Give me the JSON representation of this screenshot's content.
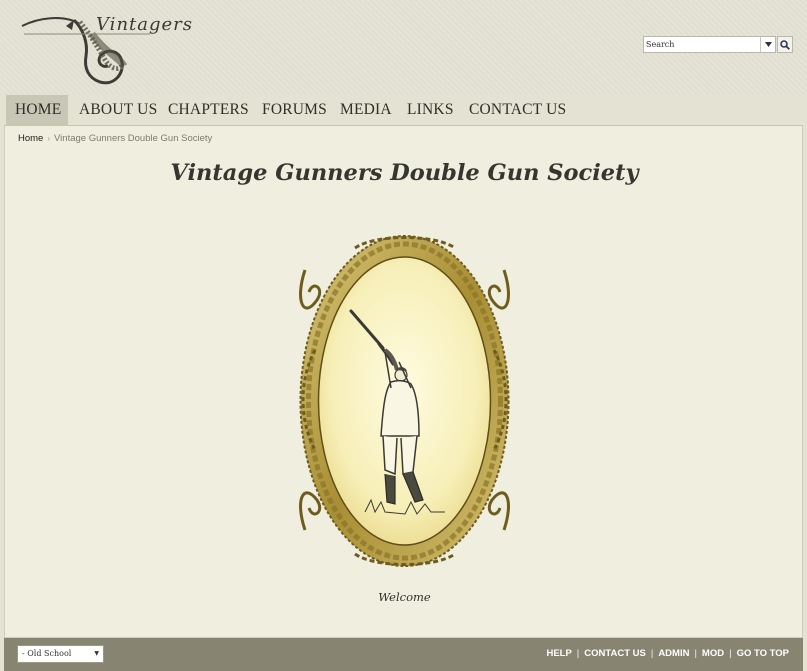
{
  "header": {
    "logo_text": "Vintagers",
    "search": {
      "placeholder": "Search"
    }
  },
  "nav": {
    "items": [
      {
        "label": "HOME"
      },
      {
        "label": "ABOUT US"
      },
      {
        "label": "CHAPTERS"
      },
      {
        "label": "FORUMS"
      },
      {
        "label": "MEDIA"
      },
      {
        "label": "LINKS"
      },
      {
        "label": "CONTACT US"
      }
    ]
  },
  "breadcrumb": {
    "home": "Home",
    "separator": "›",
    "current": "Vintage Gunners Double Gun Society"
  },
  "main": {
    "title": "Vintage Gunners Double Gun Society",
    "caption": "Welcome"
  },
  "footer": {
    "style_chooser": "- Old School",
    "links": [
      "HELP",
      "CONTACT US",
      "ADMIN",
      "MOD",
      "GO TO TOP"
    ],
    "separator": "|"
  },
  "icons": {
    "logo": "fish-logo-icon",
    "search": "search-icon",
    "dropdown": "chevron-down-icon",
    "hero": "hunter-shooting-illustration"
  },
  "colors": {
    "background": "#e4e2d2",
    "nav_active": "#c8c6b4",
    "content": "#f0efdf",
    "footer": "#878571",
    "frame_gold": "#b49c3c",
    "oval_cream": "#f6efb8"
  }
}
